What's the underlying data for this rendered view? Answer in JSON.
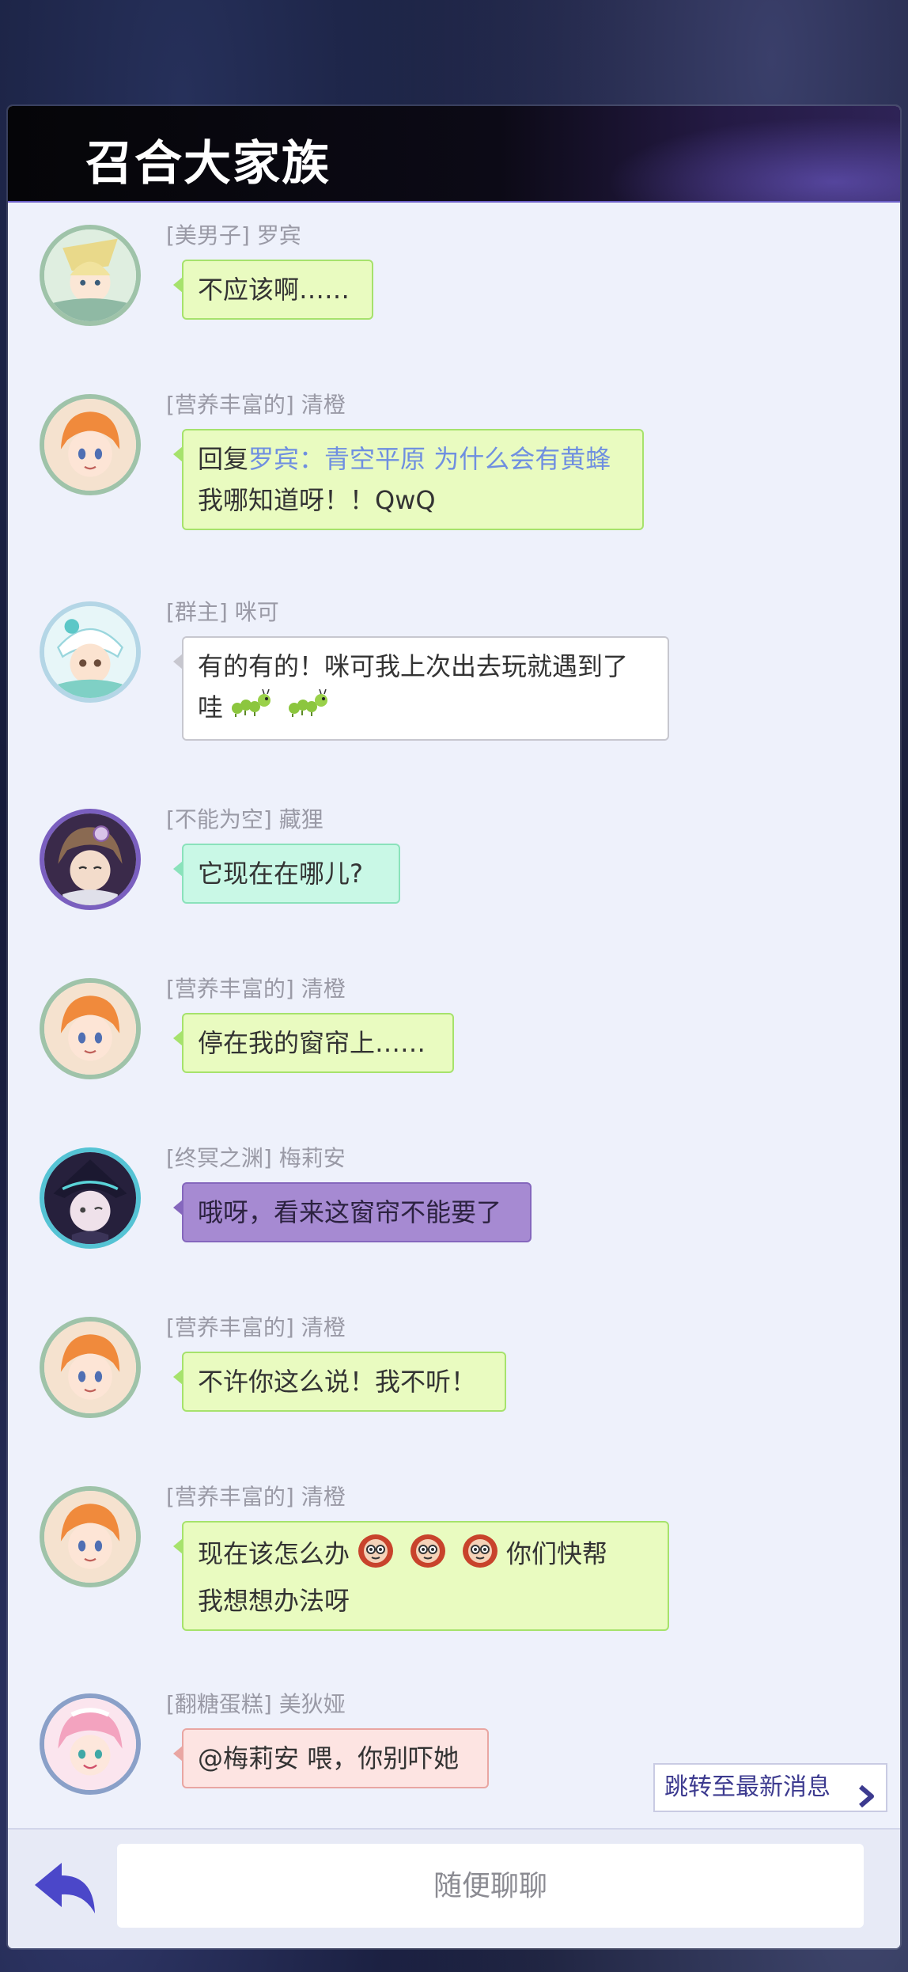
{
  "header": {
    "title": "召合大家族"
  },
  "messages": [
    {
      "sender": "[美男子] 罗宾",
      "text": "不应该啊……",
      "style": "green",
      "avatar": "robin"
    },
    {
      "sender": "[营养丰富的] 清橙",
      "reply_prefix": "回复",
      "reply_target": "罗宾：青空平原 为什么会有黄蜂",
      "text": "我哪知道呀！！QwQ",
      "style": "green",
      "avatar": "qingcheng"
    },
    {
      "sender": "[群主] 咪可",
      "text_line1": "有的有的！咪可我上次出去玩就遇到了",
      "text_line2": "哇",
      "emojis": [
        "caterpillar-icon",
        "caterpillar-icon"
      ],
      "style": "white",
      "avatar": "mike"
    },
    {
      "sender": "[不能为空] 藏狸",
      "text": "它现在在哪儿?",
      "style": "teal",
      "avatar": "zangli"
    },
    {
      "sender": "[营养丰富的] 清橙",
      "text": "停在我的窗帘上……",
      "style": "green",
      "avatar": "qingcheng"
    },
    {
      "sender": "[终冥之渊] 梅莉安",
      "text": "哦呀，看来这窗帘不能要了",
      "style": "purple",
      "avatar": "meilian"
    },
    {
      "sender": "[营养丰富的] 清橙",
      "text": "不许你这么说！我不听！",
      "style": "green",
      "avatar": "qingcheng"
    },
    {
      "sender": "[营养丰富的] 清橙",
      "text_line1a": "现在该怎么办",
      "text_line1b": "你们快帮",
      "text_line2": "我想想办法呀",
      "emojis": [
        "daruma-icon",
        "daruma-icon",
        "daruma-icon"
      ],
      "style": "green",
      "avatar": "qingcheng"
    },
    {
      "sender": "[翻糖蛋糕] 美狄娅",
      "text": "@梅莉安 喂，你别吓她",
      "style": "pink",
      "avatar": "medea"
    }
  ],
  "jump_latest": {
    "label": "跳转至最新消息"
  },
  "footer": {
    "input_placeholder": "随便聊聊",
    "back_icon": "back-arrow-icon"
  },
  "colors": {
    "bubble_green": "#e9fbc0",
    "bubble_purple": "#a68ad2",
    "bubble_pink": "#fde4e2",
    "bubble_teal": "#c9f8e6",
    "reply_link": "#6f8fe0",
    "accent": "#3c3a8f"
  }
}
